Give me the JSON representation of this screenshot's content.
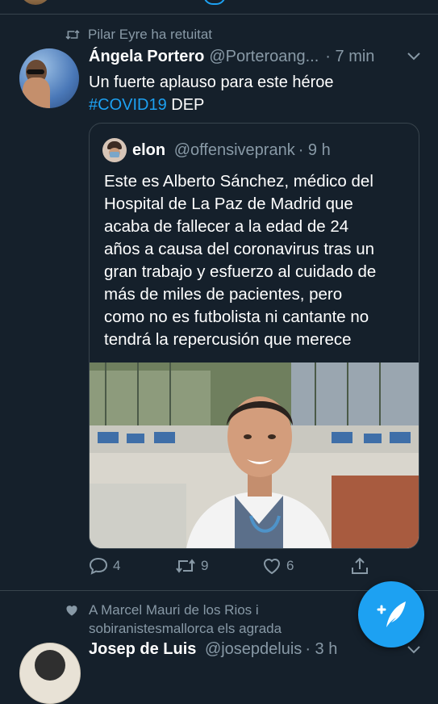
{
  "retweet_context": {
    "text": "Pilar Eyre ha retuitat"
  },
  "tweet": {
    "author_name": "Ángela Portero",
    "author_handle": "@Porteroang...",
    "time": "· 7 min",
    "text_line1": "Un fuerte aplauso para este héroe",
    "hashtag": "#COVID19",
    "text_suffix": " DEP",
    "actions": {
      "replies": "4",
      "retweets": "9",
      "likes": "6"
    }
  },
  "quoted_tweet": {
    "author_name": "elon",
    "author_handle": "@offensiveprank",
    "time": "· 9 h",
    "lines": [
      "Este es Alberto Sánchez, médico del",
      "Hospital de La Paz de Madrid que",
      "acaba de fallecer a la edad de 24",
      "años a causa del coronavirus tras un",
      "gran trabajo y esfuerzo al cuidado de",
      "más de miles de pacientes, pero",
      "como no es futbolista ni cantante no",
      "tendrá la repercusión que merece"
    ]
  },
  "like_context": {
    "line1": "A Marcel Mauri de los Rios i",
    "line2": "sobiranistesmallorca els agrada"
  },
  "next_tweet": {
    "author_name": "Josep de Luis",
    "author_handle": "@josepdeluis",
    "time": "· 3 h"
  },
  "colors": {
    "background": "#15202b",
    "accent": "#1da1f2",
    "muted": "#8899a6",
    "divider": "#38444d"
  }
}
